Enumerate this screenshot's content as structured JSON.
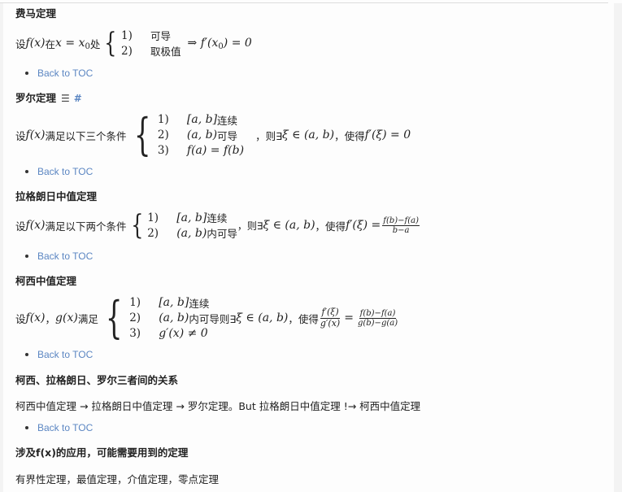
{
  "back_to_toc": "Back to TOC",
  "sections": [
    {
      "title": "费马定理",
      "formula": {
        "prefix": "设",
        "fx": "f(x)",
        "mid": "在",
        "cond": "x = x",
        "sub": "0",
        "suffix": "处",
        "cases": [
          {
            "num": "1)",
            "text": "可导"
          },
          {
            "num": "2)",
            "text": "取极值"
          }
        ],
        "result": "⇒ f′(x",
        "result_sub": "0",
        "result_tail": ") = 0"
      }
    },
    {
      "title": "罗尔定理",
      "icons": {
        "list": "list-icon",
        "hash": "#"
      },
      "formula": {
        "prefix": "设",
        "fx": "f(x)",
        "mid": "满足以下三个条件",
        "cases": [
          {
            "num": "1)",
            "math": "[a, b]",
            "text": "连续"
          },
          {
            "num": "2)",
            "math": "(a, b)",
            "text": "可导"
          },
          {
            "num": "3)",
            "math": "f(a) = f(b)",
            "text": ""
          }
        ],
        "then": "，则∃",
        "xi": "ξ ∈ (a, b)",
        "so": "，使得",
        "result": "f′(ξ) = 0"
      }
    },
    {
      "title": "拉格朗日中值定理",
      "formula": {
        "prefix": "设",
        "fx": "f(x)",
        "mid": "满足以下两个条件",
        "cases": [
          {
            "num": "1)",
            "math": "[a, b]",
            "text": "连续"
          },
          {
            "num": "2)",
            "math": "(a, b)",
            "text": "内可导"
          }
        ],
        "then": "，则∃",
        "xi": "ξ ∈ (a, b)",
        "so": "，使得",
        "result": "f′(ξ) =",
        "frac_num": "f(b)−f(a)",
        "frac_den": "b−a"
      }
    },
    {
      "title": "柯西中值定理",
      "formula": {
        "prefix": "设",
        "fx": "f(x)",
        "sep": "，",
        "gx": "g(x)",
        "mid": "满足",
        "cases": [
          {
            "num": "1)",
            "math": "[a, b]",
            "text": "连续"
          },
          {
            "num": "2)",
            "math": "(a, b)",
            "text": "内可导"
          },
          {
            "num": "3)",
            "math": "g′(x) ≠ 0",
            "text": ""
          }
        ],
        "then": " 则∃",
        "xi": "ξ ∈ (a, b)",
        "so": "，使得",
        "lhs_num": "f′(ξ)",
        "lhs_den": "g′(x)",
        "eq": "=",
        "rhs_num": "f(b)−f(a)",
        "rhs_den": "g(b)−g(a)"
      }
    },
    {
      "title": "柯西、拉格朗日、罗尔三者间的关系",
      "text": "柯西中值定理 → 拉格朗日中值定理 → 罗尔定理。But 拉格朗日中值定理 !→ 柯西中值定理"
    },
    {
      "title": "涉及f(x)的应用，可能需要用到的定理",
      "text": "有界性定理，最值定理，介值定理，零点定理"
    }
  ]
}
